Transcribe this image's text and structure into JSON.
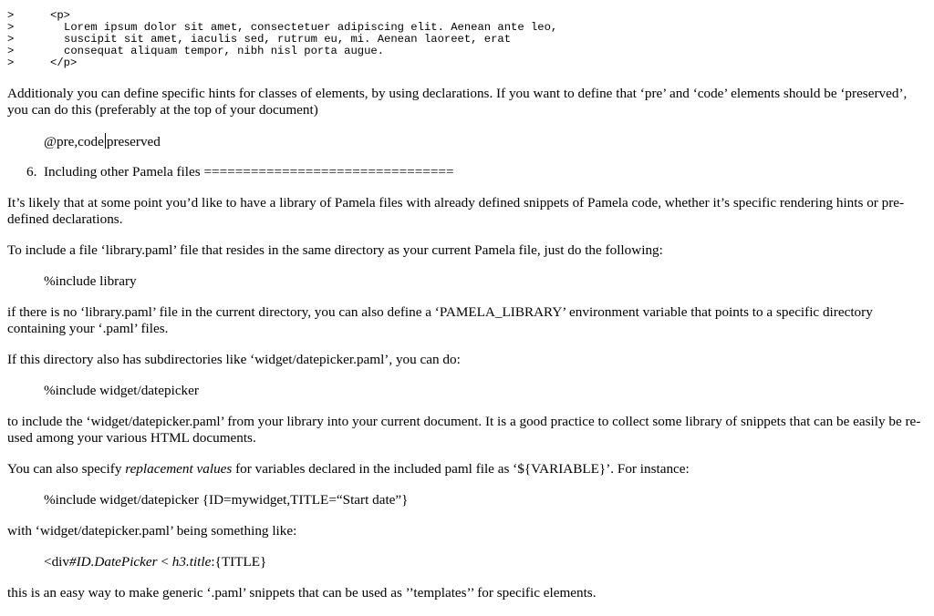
{
  "quote": {
    "marker": ">",
    "lines": [
      {
        "indent": 1,
        "text": "<p>"
      },
      {
        "indent": 2,
        "text": "Lorem ipsum dolor sit amet, consectetuer adipiscing elit. Aenean ante leo,"
      },
      {
        "indent": 2,
        "text": "suscipit sit amet, iaculis sed, rutrum eu, mi. Aenean laoreet, erat"
      },
      {
        "indent": 2,
        "text": "consequat aliquam tempor, nibh nisl porta augue."
      },
      {
        "indent": 1,
        "text": "</p>"
      }
    ]
  },
  "p_hints": "Additionaly you can define specific hints for classes of elements, by using declarations. If you want to define that ‘pre’ and ‘code’ elements should be ‘preserved’, you can do this (preferably at the top of your document)",
  "code_hints": {
    "before_caret": "@pre,code",
    "after_caret": "preserved"
  },
  "heading": {
    "number": "6.",
    "text": "Including other Pamela files ================================"
  },
  "p_library": "It’s likely that at some point you’d like to have a library of Pamela files with already defined snippets of Pamela code, whether it’s specific rendering hints or pre-defined declarations.",
  "p_include": "To include a file ‘library.paml’ file that resides in the same directory as your current Pamela file, just do the following:",
  "code_include": "%include library",
  "p_env": "if there is no ‘library.paml’ file in the current directory, you can also define a ‘PAMELA_LIBRARY’ environment variable that points to a specific directory containing your ‘.paml’ files.",
  "p_subdirs": "If this directory also has subdirectories like ‘widget/datepicker.paml’, you can do:",
  "code_datepicker": "%include widget/datepicker",
  "p_practice": "to include the ‘widget/datepicker.paml’ from your library into your current document. It is a good practice to collect some library of snippets that can be easily be re-used among your various HTML documents.",
  "p_replace": {
    "before": "You can also specify ",
    "emphasis": "replacement values",
    "after": " for variables declared in the included paml file as ‘${VARIABLE}’. For instance:"
  },
  "code_replace": "%include widget/datepicker {ID=mywidget,TITLE=“Start date”}",
  "p_with": "with ‘widget/datepicker.paml’ being something like:",
  "code_div": {
    "a": "<div",
    "b": "#ID.DatePicker",
    "c": " < ",
    "d": "h3.title",
    "e": ":{TITLE}"
  },
  "p_templates": "this is an easy way to make generic ‘.paml’ snippets that can be used as ’’templates’’ for specific elements."
}
